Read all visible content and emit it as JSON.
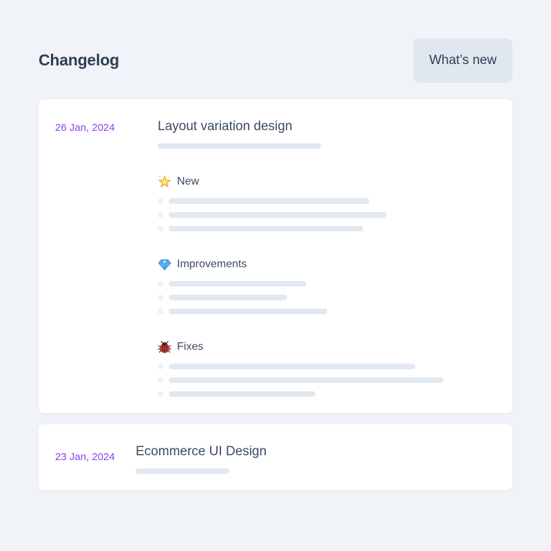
{
  "header": {
    "title": "Changelog",
    "whats_new_label": "What’s new"
  },
  "entries": [
    {
      "date": "26 Jan, 2024",
      "title": "Layout variation design",
      "sections": [
        {
          "label": "New",
          "icon": "star-icon"
        },
        {
          "label": "Improvements",
          "icon": "gem-icon"
        },
        {
          "label": "Fixes",
          "icon": "ladybug-icon"
        }
      ]
    },
    {
      "date": "23 Jan, 2024",
      "title": "Ecommerce UI Design"
    }
  ],
  "colors": {
    "background": "#f0f3f8",
    "date_accent": "#8a3ff0",
    "placeholder_bar": "#e2e8f0",
    "button_bg": "#e1e7ef"
  }
}
